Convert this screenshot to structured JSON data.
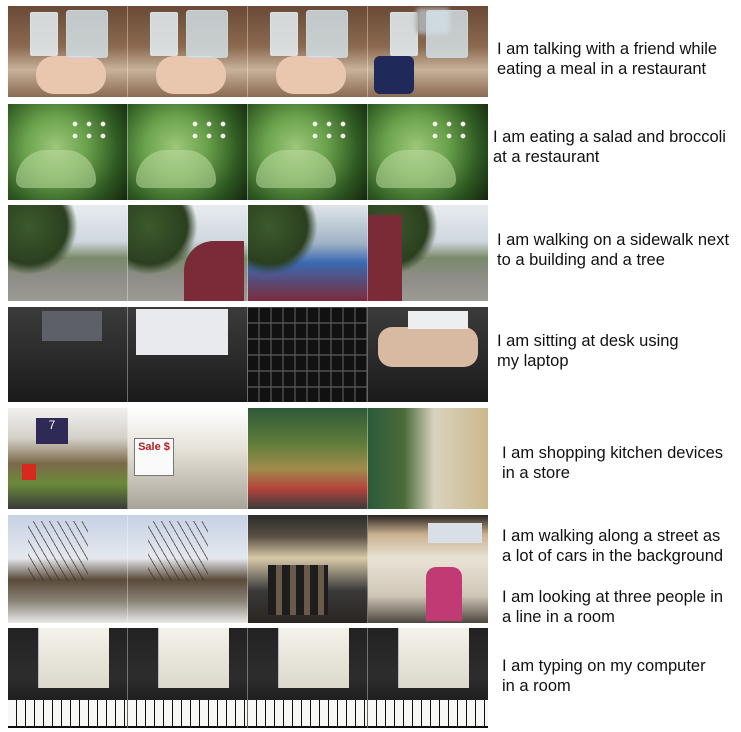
{
  "rows": [
    {
      "caption_lines": [
        "I am talking with a friend while",
        "eating a meal in a restaurant"
      ]
    },
    {
      "caption_lines": [
        "I am eating a salad and broccoli",
        "at a restaurant"
      ]
    },
    {
      "caption_lines": [
        "I am walking on a sidewalk next",
        "to a building and a tree"
      ]
    },
    {
      "caption_lines": [
        "I am sitting at desk using",
        "my laptop"
      ]
    },
    {
      "caption_lines": [
        "I am shopping kitchen devices",
        "in a store"
      ]
    },
    {
      "caption_lines": [
        "I am walking along a street as",
        "a lot of cars in the background",
        "I am looking at three people in",
        "a line in a room"
      ]
    },
    {
      "caption_lines": [
        "I am typing on my computer",
        "in a room"
      ]
    }
  ],
  "store_sign": "7",
  "sale_sign": "Sale $"
}
